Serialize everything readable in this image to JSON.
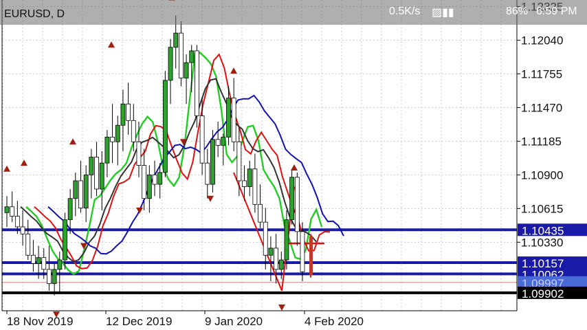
{
  "status_bar": {
    "speed": "0.5K/s",
    "battery": "86%",
    "time": "6:59 PM"
  },
  "chart_header": {
    "symbol": "EURUSD, D"
  },
  "colors": {
    "grid": "#c8c8c8",
    "candle_body": "#2fa12f",
    "candle_bear": "#c0392b",
    "ma_fast": "#e01010",
    "ma_green": "#22cc22",
    "ma_black": "#333333",
    "ma_blue": "#1010b0",
    "hline_blue": "#1a1aa8",
    "hline_black": "#000000",
    "fractal": "#a02010"
  },
  "chart_data": {
    "type": "candlestick",
    "title": "",
    "ylim": [
      1.0975,
      1.1238
    ],
    "x_ticks": [
      "18 Nov 2019",
      "12 Dec 2019",
      "9 Jan 2020",
      "4 Feb 2020"
    ],
    "y_ticks": [
      "1.12325",
      "1.12040",
      "1.11755",
      "1.11470",
      "1.11185",
      "1.10900",
      "1.10615",
      "1.10330"
    ],
    "y_tick_values": [
      1.12325,
      1.1204,
      1.11755,
      1.1147,
      1.11185,
      1.109,
      1.10615,
      1.1033
    ],
    "price_labels": [
      {
        "value": 1.10435,
        "text": "1.10435",
        "style": "blue"
      },
      {
        "value": 1.10157,
        "text": "1.10157",
        "style": "blue"
      },
      {
        "value": 1.10062,
        "text": "1.10062",
        "style": "blue"
      },
      {
        "value": 1.0999,
        "text": "1.09997",
        "style": "blue-faint"
      },
      {
        "value": 1.09902,
        "text": "1.09902",
        "style": "black"
      }
    ],
    "horizontal_lines": [
      {
        "value": 1.10435,
        "color": "blue"
      },
      {
        "value": 1.10157,
        "color": "blue"
      },
      {
        "value": 1.10062,
        "color": "blue"
      },
      {
        "value": 1.09902,
        "color": "black"
      }
    ],
    "candles": [
      [
        1.1058,
        1.1072,
        1.1046,
        1.1063
      ],
      [
        1.1063,
        1.1076,
        1.105,
        1.1055
      ],
      [
        1.1055,
        1.1068,
        1.104,
        1.1046
      ],
      [
        1.1046,
        1.106,
        1.103,
        1.104
      ],
      [
        1.104,
        1.1052,
        1.1018,
        1.1022
      ],
      [
        1.1022,
        1.1035,
        1.1008,
        1.1015
      ],
      [
        1.1015,
        1.103,
        1.1002,
        1.102
      ],
      [
        1.102,
        1.1028,
        0.0,
        1.101
      ],
      [
        1.101,
        1.103,
        1.0992,
        1.0998
      ],
      [
        1.0998,
        1.1015,
        1.0988,
        1.101
      ],
      [
        1.101,
        1.1025,
        1.099,
        1.1018
      ],
      [
        1.1018,
        1.1058,
        1.101,
        1.1052
      ],
      [
        1.1052,
        1.1078,
        1.104,
        1.107
      ],
      [
        1.107,
        1.1092,
        1.1055,
        1.1085
      ],
      [
        1.1085,
        1.1102,
        1.1058,
        1.1062
      ],
      [
        1.1062,
        1.1098,
        1.105,
        1.109
      ],
      [
        1.109,
        1.1112,
        1.107,
        1.1105
      ],
      [
        1.1105,
        1.1118,
        1.1072,
        1.1078
      ],
      [
        1.1078,
        1.111,
        1.106,
        1.11
      ],
      [
        1.11,
        1.1128,
        1.1088,
        1.1122
      ],
      [
        1.1122,
        1.115,
        1.11,
        1.1118
      ],
      [
        1.1118,
        1.114,
        1.1098,
        1.1132
      ],
      [
        1.1132,
        1.1162,
        1.111,
        1.115
      ],
      [
        1.115,
        1.1168,
        1.1124,
        1.1136
      ],
      [
        1.1136,
        1.115,
        1.111,
        1.1118
      ],
      [
        1.1118,
        1.1135,
        1.1088,
        1.1098
      ],
      [
        1.1098,
        1.1112,
        1.106,
        1.107
      ],
      [
        1.107,
        1.1098,
        1.1058,
        1.109
      ],
      [
        1.109,
        1.1102,
        1.1072,
        1.1082
      ],
      [
        1.1082,
        1.11,
        1.107,
        1.1092
      ],
      [
        1.1092,
        1.1178,
        1.1088,
        1.117
      ],
      [
        1.117,
        1.1205,
        1.115,
        1.1198
      ],
      [
        1.1198,
        1.1225,
        1.118,
        1.121
      ],
      [
        1.121,
        1.122,
        1.1165,
        1.1172
      ],
      [
        1.1172,
        1.1192,
        1.115,
        1.1185
      ],
      [
        1.1185,
        1.12,
        1.116,
        1.1195
      ],
      [
        1.1195,
        1.12,
        1.113,
        1.114
      ],
      [
        1.114,
        1.1155,
        1.109,
        1.11
      ],
      [
        1.11,
        1.1112,
        1.107,
        1.1082
      ],
      [
        1.1082,
        1.1128,
        1.1075,
        1.112
      ],
      [
        1.112,
        1.1135,
        1.1105,
        1.1115
      ],
      [
        1.1115,
        1.1125,
        1.1098,
        1.1122
      ],
      [
        1.1122,
        1.1165,
        1.1115,
        1.1155
      ],
      [
        1.1155,
        1.1172,
        1.111,
        1.1118
      ],
      [
        1.1118,
        1.113,
        1.1072,
        1.1085
      ],
      [
        1.1085,
        1.1098,
        1.1068,
        1.108
      ],
      [
        1.108,
        1.1102,
        1.1072,
        1.1095
      ],
      [
        1.1095,
        1.1108,
        1.1058,
        1.1065
      ],
      [
        1.1065,
        1.1082,
        1.1045,
        1.105
      ],
      [
        1.105,
        1.1062,
        1.101,
        1.1022
      ],
      [
        1.1022,
        1.1038,
        1.1,
        1.1028
      ],
      [
        1.1028,
        1.104,
        1.0998,
        1.101
      ],
      [
        1.101,
        1.1025,
        0.0,
        1.1018
      ],
      [
        1.1018,
        1.106,
        1.101,
        1.1052
      ],
      [
        1.1052,
        1.1095,
        1.1048,
        1.1088
      ],
      [
        1.1088,
        1.1092,
        1.103,
        1.1042
      ],
      [
        1.1042,
        1.105,
        1.1,
        1.1008
      ]
    ]
  }
}
